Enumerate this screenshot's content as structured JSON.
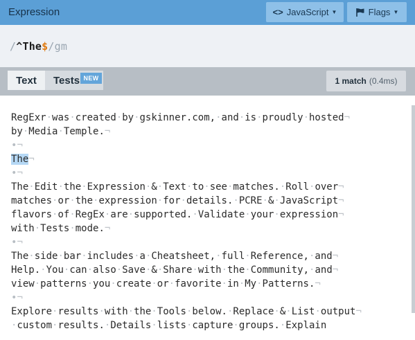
{
  "header": {
    "title": "Expression",
    "language_button": "JavaScript",
    "flags_button": "Flags"
  },
  "expression": {
    "open_delim": "/",
    "anchor_start": "^",
    "literal": "The",
    "anchor_end": "$",
    "close_delim": "/",
    "flags": "gm"
  },
  "tabs": {
    "text_label": "Text",
    "tests_label": "Tests",
    "new_badge": "NEW"
  },
  "match_info": {
    "count": "1 match",
    "time": "(0.4ms)"
  },
  "text_lines": [
    "RegExr was created by gskinner.com, and is proudly hosted",
    "by Media Temple.",
    "",
    "The",
    "",
    "The Edit the Expression & Text to see matches. Roll over",
    "matches or the expression for details. PCRE & JavaScript",
    "flavors of RegEx are supported. Validate your expression",
    "with Tests mode.",
    "",
    "The side bar includes a Cheatsheet, full Reference, and",
    "Help. You can also Save & Share with the Community, and",
    "view patterns you create or favorite in My Patterns.",
    "",
    "Explore results with the Tools below. Replace & List output",
    " custom results. Details lists capture groups. Explain"
  ],
  "highlight_line": 3,
  "colors": {
    "header_bg": "#5b9fd6",
    "match_highlight": "#b5d8f5",
    "end_anchor": "#e07b12"
  }
}
